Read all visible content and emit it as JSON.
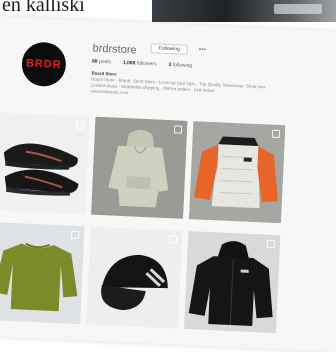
{
  "caption": "en kalliski",
  "profile": {
    "username": "brdrstore",
    "follow_label": "Following",
    "more_icon": "ellipsis-icon",
    "stats": [
      {
        "count": "88",
        "label": "posts"
      },
      {
        "count": "1,088",
        "label": "followers"
      },
      {
        "count": "3",
        "label": "following"
      }
    ],
    "bio_name": "Board Store",
    "bio_lines": [
      "Board Store · Brand· Sport Store · Level up your style · Top Quality Streetwear. Shop now",
      "Limited drops · Worldwide shipping · DM for orders · Link below",
      "www.brdrstore.com"
    ],
    "avatar_text": "BRDR"
  },
  "posts": [
    {
      "item": "sneakers"
    },
    {
      "item": "hoodie"
    },
    {
      "item": "orange-jacket"
    },
    {
      "item": "green-sweater"
    },
    {
      "item": "black-cap"
    },
    {
      "item": "black-jacket"
    }
  ],
  "colors": {
    "avatar_bg": "#0c0c0c",
    "avatar_logo": "#e3201e",
    "jacket_orange": "#e8652a"
  }
}
